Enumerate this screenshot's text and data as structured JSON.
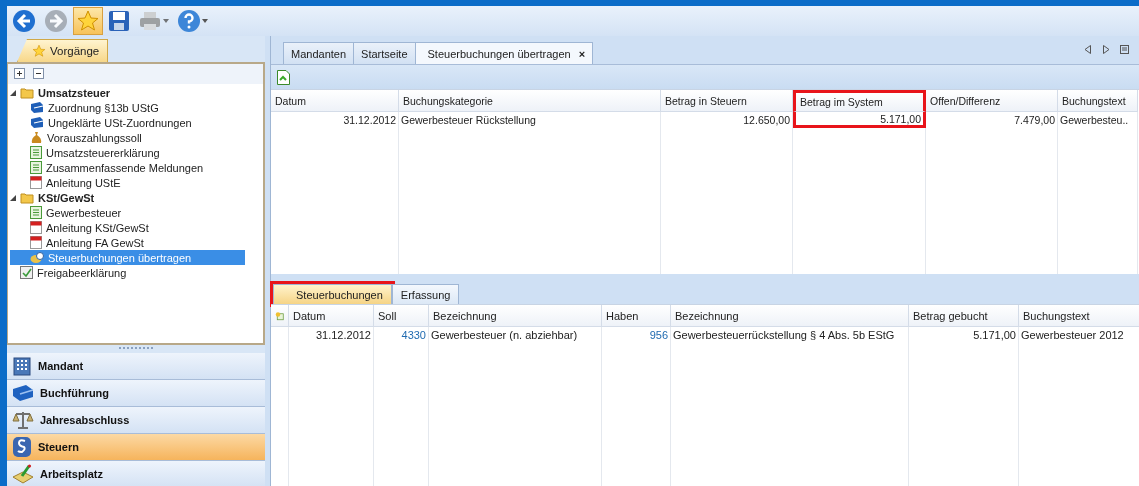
{
  "toolbar": {
    "buttons": [
      {
        "kind": "back",
        "disabled": false,
        "selected": false
      },
      {
        "kind": "forward",
        "disabled": true,
        "selected": false
      },
      {
        "kind": "favorite",
        "disabled": false,
        "selected": true
      },
      {
        "kind": "save",
        "disabled": false,
        "selected": false
      },
      {
        "kind": "print",
        "disabled": true,
        "selected": false
      },
      {
        "kind": "help",
        "disabled": false,
        "selected": false
      }
    ]
  },
  "sidebar": {
    "tab": "Vorgänge",
    "tree": [
      {
        "label": "Umsatzsteuer",
        "kind": "folder",
        "expanded": true,
        "selected": false,
        "children": [
          {
            "label": "Zuordnung §13b UStG",
            "kind": "book",
            "selected": false
          },
          {
            "label": "Ungeklärte USt-Zuordnungen",
            "kind": "book",
            "selected": false
          },
          {
            "label": "Vorauszahlungssoll",
            "kind": "moneybag",
            "selected": false
          },
          {
            "label": "Umsatzsteuererklärung",
            "kind": "form",
            "selected": false
          },
          {
            "label": "Zusammenfassende Meldungen",
            "kind": "form",
            "selected": false
          },
          {
            "label": "Anleitung UStE",
            "kind": "pdf",
            "selected": false
          }
        ]
      },
      {
        "label": "KSt/GewSt",
        "kind": "folder",
        "expanded": true,
        "selected": false,
        "children": [
          {
            "label": "Gewerbesteuer",
            "kind": "form",
            "selected": false
          },
          {
            "label": "Anleitung KSt/GewSt",
            "kind": "pdf",
            "selected": false
          },
          {
            "label": "Anleitung FA GewSt",
            "kind": "pdf",
            "selected": false
          },
          {
            "label": "Steuerbuchungen übertragen",
            "kind": "transfer",
            "selected": true
          }
        ]
      },
      {
        "label": "Freigabeerklärung",
        "kind": "release",
        "selected": false
      }
    ],
    "nav": [
      {
        "label": "Mandant",
        "kind": "building",
        "selected": false
      },
      {
        "label": "Buchführung",
        "kind": "book",
        "selected": false
      },
      {
        "label": "Jahresabschluss",
        "kind": "scales",
        "selected": false
      },
      {
        "label": "Steuern",
        "kind": "paragraph",
        "selected": true
      },
      {
        "label": "Arbeitsplatz",
        "kind": "desk",
        "selected": false
      }
    ]
  },
  "tabs": [
    {
      "label": "Mandanten",
      "selected": false
    },
    {
      "label": "Startseite",
      "selected": false
    },
    {
      "label": "Steuerbuchungen übertragen",
      "selected": true,
      "close": "×"
    }
  ],
  "upper_table": {
    "columns": [
      {
        "label": "Datum",
        "numeric": true,
        "highlighted": false
      },
      {
        "label": "Buchungskategorie",
        "numeric": false,
        "highlighted": false
      },
      {
        "label": "Betrag in Steuern",
        "numeric": true,
        "highlighted": false
      },
      {
        "label": "Betrag im System",
        "numeric": true,
        "highlighted": true
      },
      {
        "label": "Offen/Differenz",
        "numeric": true,
        "highlighted": false
      },
      {
        "label": "Buchungstext",
        "numeric": false,
        "highlighted": false
      }
    ],
    "rows": [
      [
        "31.12.2012",
        "Gewerbesteuer Rückstellung",
        "12.650,00",
        "5.171,00",
        "7.479,00",
        "Gewerbesteu.."
      ]
    ]
  },
  "sub_tabs": [
    {
      "label": "Steuerbuchungen",
      "selected": true,
      "highlighted": true
    },
    {
      "label": "Erfassung",
      "selected": false,
      "highlighted": false
    }
  ],
  "lower_table": {
    "columns": [
      {
        "label": "Datum",
        "numeric": true,
        "link": false
      },
      {
        "label": "Soll",
        "numeric": true,
        "link": true
      },
      {
        "label": "Bezeichnung",
        "numeric": false,
        "link": false
      },
      {
        "label": "Haben",
        "numeric": true,
        "link": true
      },
      {
        "label": "Bezeichnung",
        "numeric": false,
        "link": false
      },
      {
        "label": "Betrag gebucht",
        "numeric": true,
        "link": false
      },
      {
        "label": "Buchungstext",
        "numeric": false,
        "link": false
      }
    ],
    "rows": [
      [
        "31.12.2012",
        "4330",
        "Gewerbesteuer (n. abziehbar)",
        "956",
        "Gewerbesteuerrückstellung § 4 Abs. 5b EStG",
        "5.171,00",
        "Gewerbesteuer 2012"
      ]
    ]
  }
}
